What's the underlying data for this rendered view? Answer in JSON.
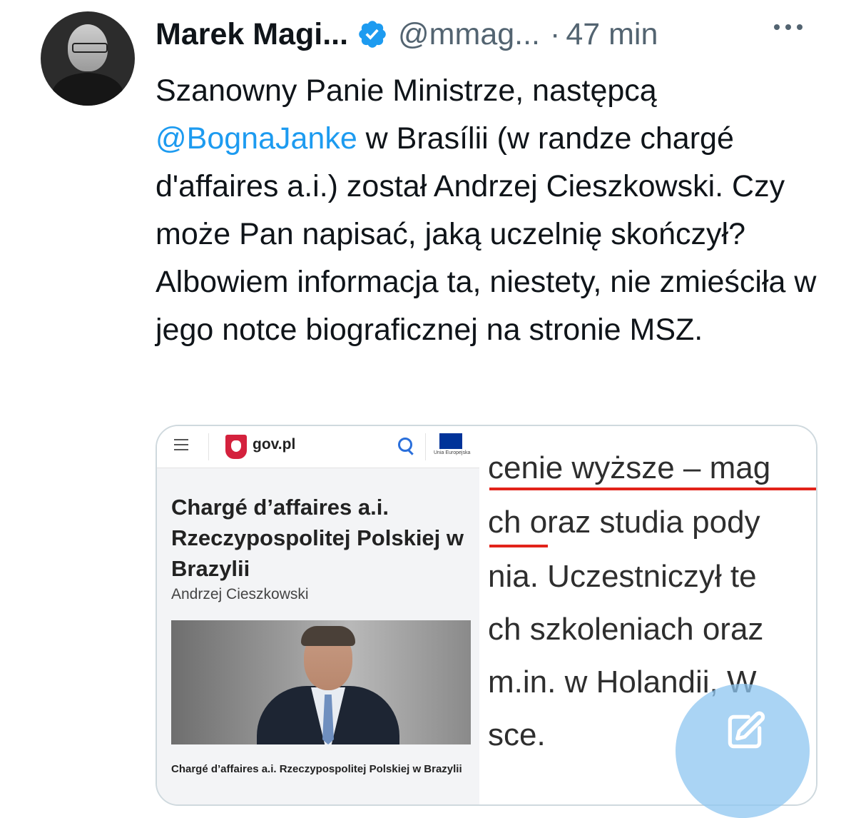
{
  "tweet": {
    "author_name": "Marek Magi...",
    "handle": "@mmag...",
    "separator": "·",
    "time": "47 min",
    "text_parts": {
      "p1": "Szanowny Panie Ministrze, następcą ",
      "mention": "@BognaJanke",
      "p2": " w Brasílii (w randze chargé d'affaires a.i.) został Andrzej Cieszkowski. Czy może Pan napisać, jaką uczelnię skończył? Albowiem informacja ta, niestety, nie zmieściła w jego notce biograficznej na stronie MSZ."
    }
  },
  "media": {
    "site": "gov.pl",
    "eu_caption": "Unia Europejska",
    "article_title": "Chargé d’affaires a.i. Rzeczypospolitej Polskiej w Brazylii",
    "author": "Andrzej Cieszkowski",
    "caption": "Chargé d’affaires a.i. Rzeczypospolitej Polskiej w Brazylii",
    "zoom_lines": [
      "cenie wyższe – mag",
      "ch oraz studia pody",
      "nia. Uczestniczył te",
      "ch szkoleniach oraz",
      "m.in. w Holandii, W",
      "sce."
    ]
  },
  "colors": {
    "accent": "#1d9bf0",
    "underline": "#e2231a",
    "muted": "#536471"
  },
  "icons": {
    "verified": "verified-badge-icon",
    "more": "more-icon",
    "compose": "compose-icon",
    "search": "search-icon",
    "menu": "menu-icon"
  }
}
